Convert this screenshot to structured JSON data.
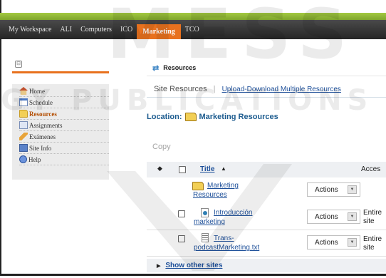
{
  "nav": {
    "items": [
      {
        "label": "My Workspace",
        "active": false
      },
      {
        "label": "ALI",
        "active": false
      },
      {
        "label": "Computers",
        "active": false
      },
      {
        "label": "ICO",
        "active": false
      },
      {
        "label": "Marketing",
        "active": true
      },
      {
        "label": "TCO",
        "active": false
      }
    ]
  },
  "tools": {
    "items": [
      {
        "label": "Home",
        "icon": "home-icon"
      },
      {
        "label": "Schedule",
        "icon": "calendar-icon"
      },
      {
        "label": "Resources",
        "icon": "folder-icon",
        "active": true
      },
      {
        "label": "Assignments",
        "icon": "assignment-icon"
      },
      {
        "label": "Exámenes",
        "icon": "pencil-icon"
      },
      {
        "label": "Site Info",
        "icon": "site-info-icon"
      },
      {
        "label": "Help",
        "icon": "help-icon"
      }
    ]
  },
  "main": {
    "title": "Resources",
    "view_current": "Site Resources",
    "view_separator": "|",
    "view_link": "Upload-Download Multiple Resources",
    "location_label": "Location:",
    "location_value": "Marketing Resources",
    "copy_label": "Copy"
  },
  "table": {
    "header_title": "Title",
    "header_access": "Acces",
    "rows": [
      {
        "name_line1": "Marketing",
        "name_line2": "Resources",
        "actions": "Actions",
        "access_line1": "",
        "access_line2": "",
        "icon": "folder-icon"
      },
      {
        "name_line1": "Introducción",
        "name_line2": "marketing",
        "actions": "Actions",
        "access_line1": "Entire",
        "access_line2": "site",
        "icon": "web-link-icon"
      },
      {
        "name_line1": "Trans-",
        "name_line2": "podcastMarketing.txt",
        "actions": "Actions",
        "access_line1": "Entire",
        "access_line2": "site",
        "icon": "text-file-icon"
      }
    ]
  },
  "other_sites": "Show other sites",
  "watermark": {
    "line1": "MESS",
    "line2": "DGY PUBLICATIONS"
  },
  "colors": {
    "accent": "#e8711e",
    "link": "#1d4f99",
    "topbar": "#2e2e2e",
    "green": "#8ab335"
  }
}
